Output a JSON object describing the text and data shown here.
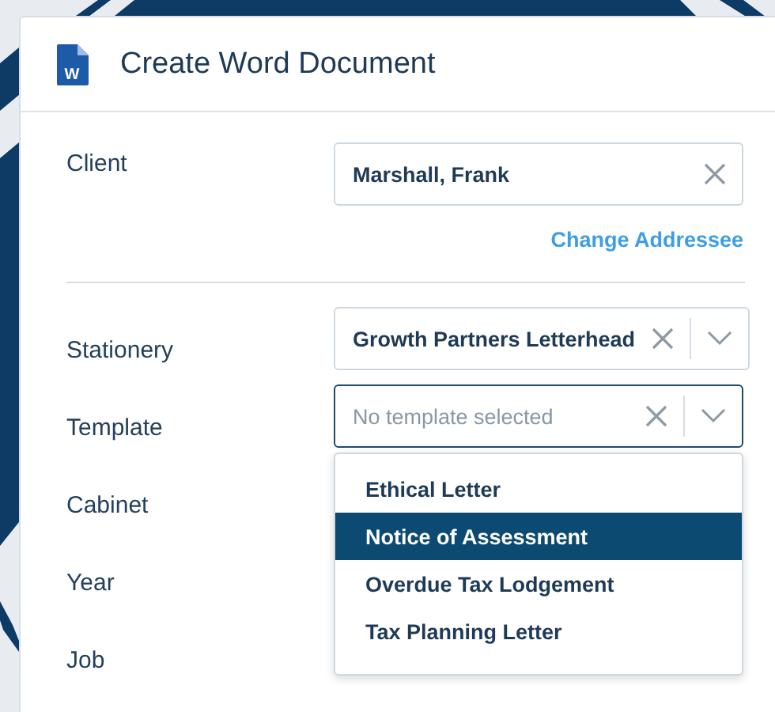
{
  "dialog": {
    "title": "Create Word Document",
    "icon_letter": "W"
  },
  "client": {
    "label": "Client",
    "value": "Marshall, Frank",
    "link": "Change Addressee"
  },
  "fields": [
    {
      "label": "Stationery",
      "kind": "select",
      "value": "Growth Partners Letterhead",
      "focused": false
    },
    {
      "label": "Template",
      "kind": "select",
      "placeholder": "No template selected",
      "focused": true
    },
    {
      "label": "Cabinet",
      "kind": "hidden"
    },
    {
      "label": "Year",
      "kind": "hidden"
    },
    {
      "label": "Job",
      "kind": "hidden"
    }
  ],
  "dropdown": {
    "options": [
      {
        "label": "Ethical Letter",
        "selected": false
      },
      {
        "label": "Notice of Assessment",
        "selected": true
      },
      {
        "label": "Overdue Tax Lodgement",
        "selected": false
      },
      {
        "label": "Tax Planning Letter",
        "selected": false
      }
    ]
  }
}
